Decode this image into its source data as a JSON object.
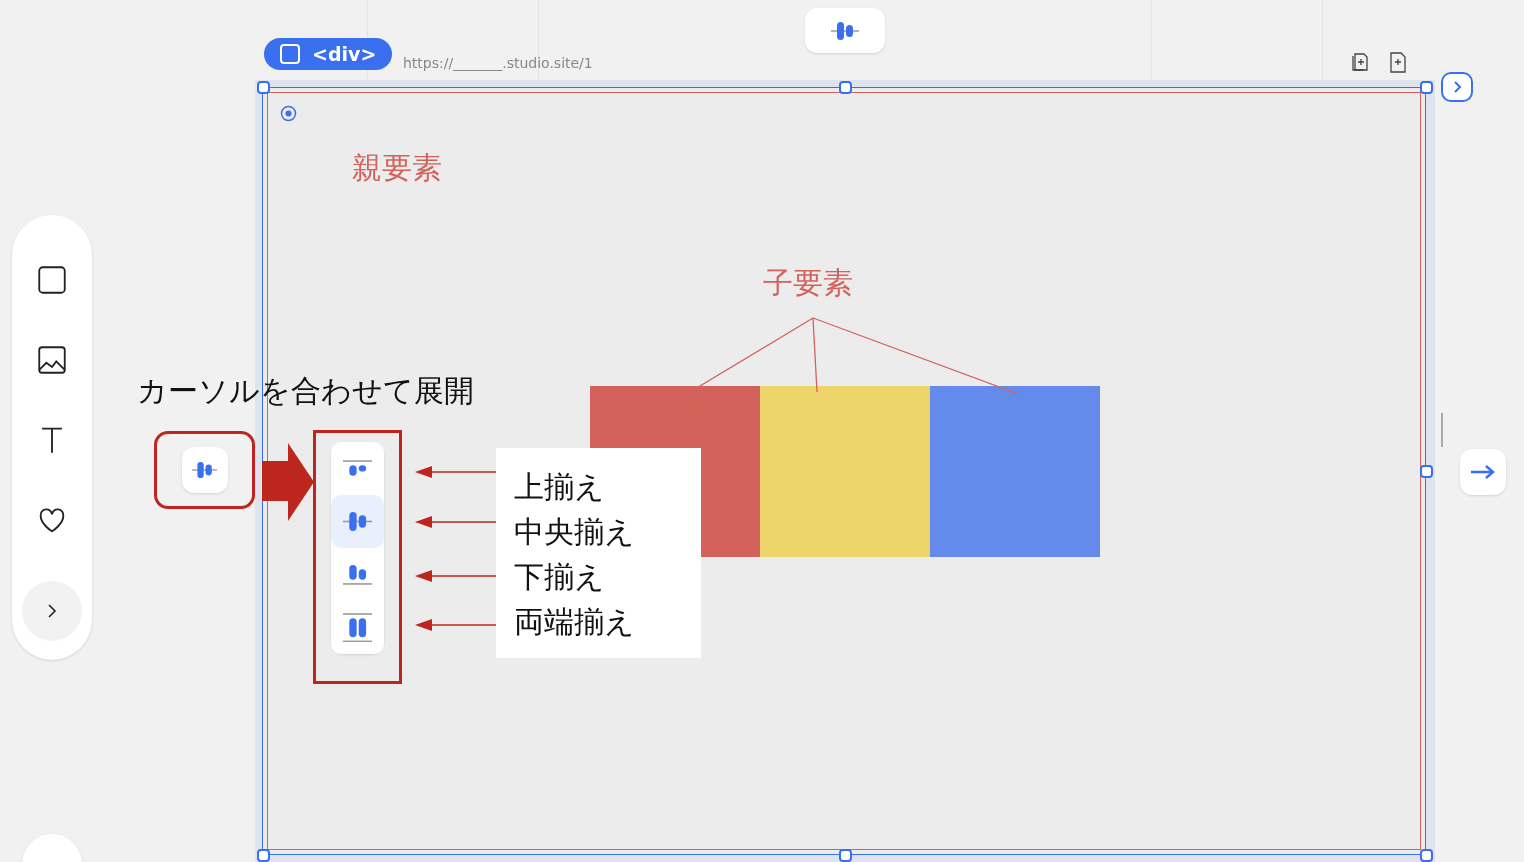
{
  "element_badge": {
    "tag": "<div>"
  },
  "url": "https://_______.studio.site/1",
  "parent_label": "親要素",
  "child_label": "子要素",
  "child_boxes": [
    {
      "color": "#d4625c"
    },
    {
      "color": "#edd46b"
    },
    {
      "color": "#648bec"
    }
  ],
  "hover_caption": "カーソルを合わせて展開",
  "toolbar_tools": [
    {
      "kind": "box"
    },
    {
      "kind": "image"
    },
    {
      "kind": "text"
    },
    {
      "kind": "heart"
    },
    {
      "kind": "more"
    }
  ],
  "align_menu": [
    {
      "kind": "top",
      "selected": false
    },
    {
      "kind": "center",
      "selected": true
    },
    {
      "kind": "bottom",
      "selected": false
    },
    {
      "kind": "stretch",
      "selected": false
    }
  ],
  "align_labels": [
    "上揃え",
    "中央揃え",
    "下揃え",
    "両端揃え"
  ]
}
